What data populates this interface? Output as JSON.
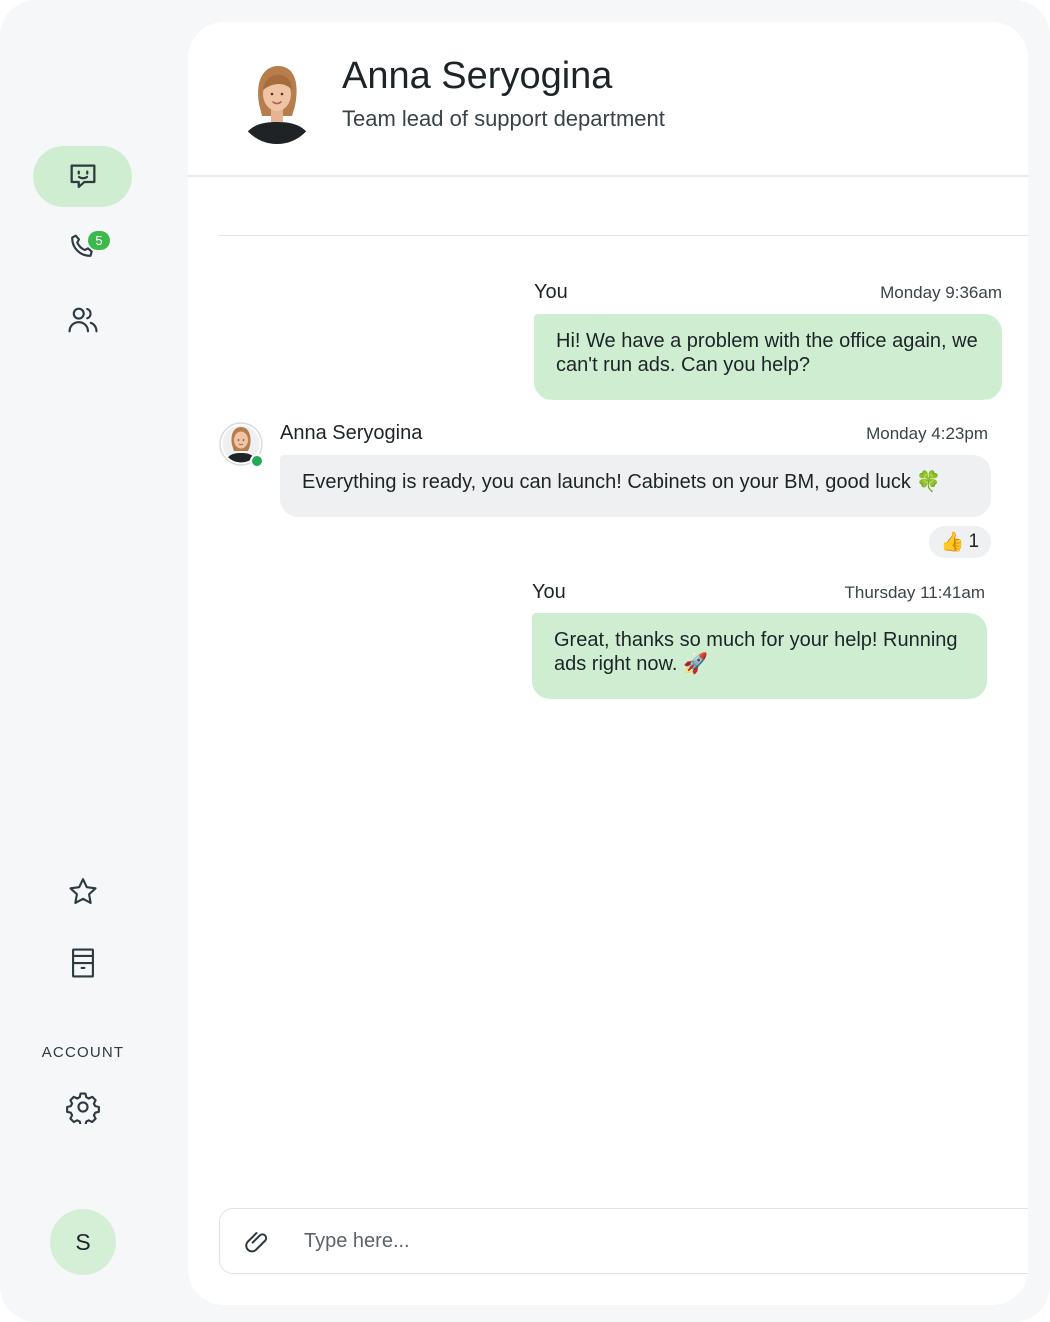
{
  "sidebar": {
    "calls_badge": "5",
    "account_label": "ACCOUNT",
    "user_initial": "S",
    "items": [
      {
        "name": "chats",
        "icon": "chat-smile-icon",
        "active": true
      },
      {
        "name": "calls",
        "icon": "phone-icon"
      },
      {
        "name": "contacts",
        "icon": "users-icon"
      },
      {
        "name": "favorites",
        "icon": "star-icon"
      },
      {
        "name": "archive",
        "icon": "archive-icon"
      },
      {
        "name": "settings",
        "icon": "gear-icon"
      }
    ]
  },
  "header": {
    "name": "Anna Seryogina",
    "role": "Team lead of support department",
    "avatar": "contact-avatar-photo"
  },
  "messages": [
    {
      "sender": "You",
      "time": "Monday 9:36am",
      "text": "Hi! We have a problem with the office again, we can't run ads. Can you help?",
      "direction": "outgoing"
    },
    {
      "sender": "Anna Seryogina",
      "time": "Monday 4:23pm",
      "text": "Everything is ready, you can launch! Cabinets on your BM, good luck 🍀",
      "direction": "incoming",
      "online": true,
      "reaction": {
        "emoji": "👍",
        "count": "1"
      }
    },
    {
      "sender": "You",
      "time": "Thursday 11:41am",
      "text": "Great, thanks so much for your help! Running ads right now. 🚀",
      "direction": "outgoing"
    }
  ],
  "composer": {
    "placeholder": "Type here...",
    "value": "",
    "attach_icon": "paperclip-icon"
  },
  "colors": {
    "accent_bg": "#cfeed1",
    "badge": "#3db94c",
    "online": "#22a95a",
    "incoming_bubble": "#eef0f1",
    "app_bg": "#f5f7f8"
  }
}
